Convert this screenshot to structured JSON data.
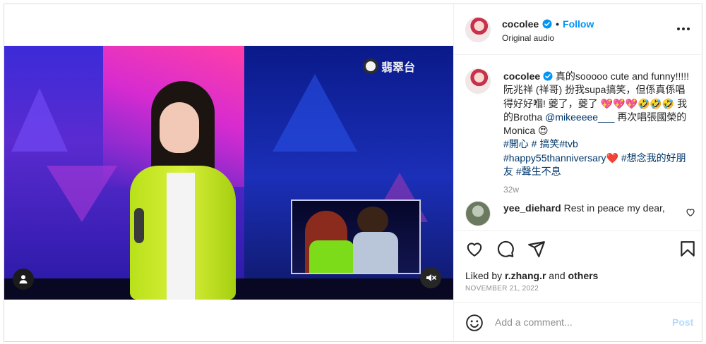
{
  "post": {
    "author": "cocolee",
    "follow_label": "Follow",
    "separator": "•",
    "audio_label": "Original audio"
  },
  "media": {
    "channel_logo_text": "翡翠台"
  },
  "caption": {
    "username": "cocolee",
    "text_part1": " 真的sooooo cute and funny!!!!! 阮兆祥 (祥哥) 扮我supa搞笑，但係真係唱得好好嗰! 夔了，夔了 ",
    "emojis": "💖💖💖🤣🤣🤣",
    "text_part2": " 我的Brotha ",
    "mention": "@mikeeeee___",
    "text_part3": " 再次唱張國榮的Monica ",
    "emoji2": "😍",
    "hashtags_line": "#開心 # 搞笑#tvb",
    "hashtag_anniv": "#happy55thanniversary",
    "heart": "❤️",
    "hashtags_end": " #想念我的好朋友 #聲生不息",
    "time": "32w"
  },
  "comment": {
    "username": "yee_diehard",
    "text": "Rest in peace my dear,"
  },
  "engagement": {
    "liked_by_prefix": "Liked by ",
    "liked_by_user": "r.zhang.r",
    "liked_by_middle": " and ",
    "liked_by_others": "others",
    "date": "NOVEMBER 21, 2022"
  },
  "comment_box": {
    "placeholder": "Add a comment...",
    "post_label": "Post"
  },
  "colors": {
    "accent": "#0095f6",
    "link": "#00376b",
    "muted": "#8e8e8e",
    "post_disabled": "#b3dbff"
  }
}
